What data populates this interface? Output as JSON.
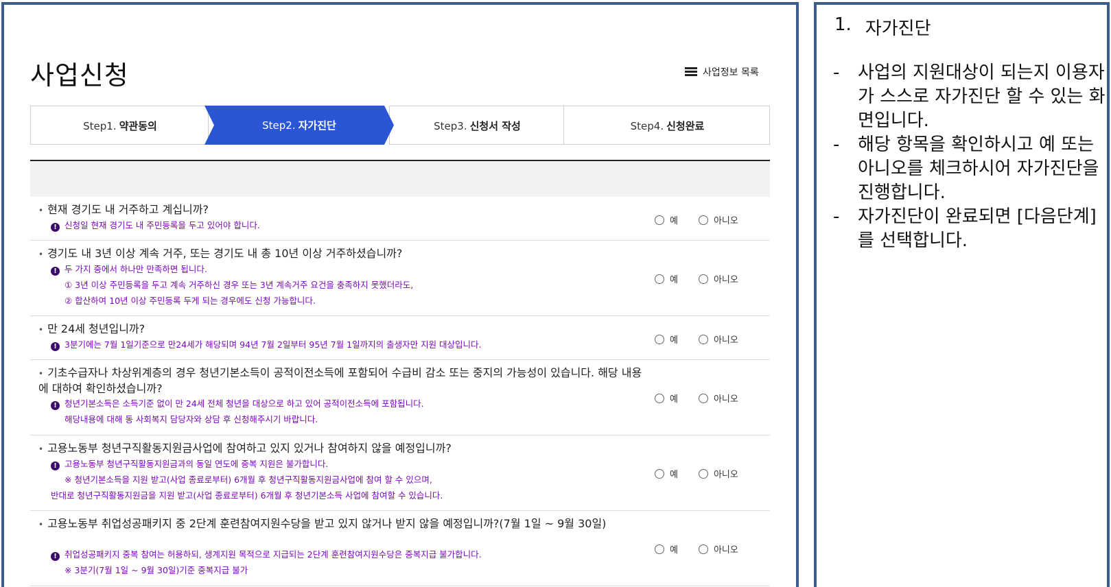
{
  "page": {
    "title": "사업신청",
    "list_link": "사업정보 목록"
  },
  "steps": [
    {
      "prefix": "Step1.",
      "label": "약관동의",
      "active": false
    },
    {
      "prefix": "Step2.",
      "label": "자가진단",
      "active": true
    },
    {
      "prefix": "Step3.",
      "label": "신청서 작성",
      "active": false
    },
    {
      "prefix": "Step4.",
      "label": "신청완료",
      "active": false
    }
  ],
  "colors": {
    "active_step": "#2a55d4",
    "note_text": "#7a0ab8",
    "panel_border": "#3b5c8e"
  },
  "radio_labels": {
    "yes": "예",
    "no": "아니오"
  },
  "questions": [
    {
      "title": "현재 경기도 내 거주하고 계십니까?",
      "note": "신청일 현재 경기도 내 주민등록을 두고 있어야 합니다.",
      "subs": []
    },
    {
      "title": "경기도 내 3년 이상 계속 거주, 또는 경기도 내 총 10년 이상 거주하셨습니까?",
      "note": "두 가지 중에서 하나만 만족하면 됩니다.",
      "subs": [
        "① 3년 이상 주민등록을 두고 계속 거주하신 경우 또는 3년 계속거주 요건을 충족하지 못했더라도,",
        "② 합산하여 10년 이상 주민등록 두게 되는 경우에도 신청 가능합니다."
      ]
    },
    {
      "title": "만 24세 청년입니까?",
      "note": "3분기에는 7월 1일기준으로 만24세가 해당되며 94년 7월 2일부터 95년 7월 1일까지의 출생자만 지원 대상입니다.",
      "subs": []
    },
    {
      "title": "기초수급자나 차상위계층의 경우 청년기본소득이 공적이전소득에 포함되어 수급비 감소 또는 중지의 가능성이 있습니다. 해당 내용에 대하여 확인하셨습니까?",
      "note": "청년기본소득은 소득기준 없이 만 24세 전체 청년을 대상으로 하고 있어 공적이전소득에 포함됩니다.",
      "subs": [
        "해당내용에 대해 동 사회복지 담당자와 상담 후 신청해주시기 바랍니다."
      ]
    },
    {
      "title": "고용노동부 청년구직활동지원금사업에 참여하고 있지 있거나 참여하지 않을 예정입니까?",
      "note": "고용노동부 청년구직활동지원금과의 동일 연도에 중복 지원은 불가합니다.",
      "subs": [
        "※ 청년기본소득을 지원 받고(사업 종료로부터) 6개월 후 청년구직활동지원금사업에 참여 할 수 있으며,",
        "반대로 청년구직활동지원금을 지원 받고(사업 종료로부터) 6개월 후 청년기본소득 사업에 참여할 수 있습니다."
      ]
    },
    {
      "title": "고용노동부 취업성공패키지 중 2단계 훈련참여지원수당을 받고 있지 않거나 받지 않을 예정입니까?(7월 1일 ~ 9월 30일)",
      "note": "취업성공패키지 중복 참여는 허용하되, 생계지원 목적으로 지급되는 2단계 훈련참여지원수당은 중복지급 불가합니다.",
      "subs": [
        "※ 3분기(7월 1일 ~ 9월 30일)기준 중복지급 불가"
      ]
    }
  ],
  "side": {
    "num": "1.",
    "heading": "자가진단",
    "items": [
      "사업의 지원대상이 되는지 이용자가 스스로 자가진단 할 수 있는 화면입니다.",
      "해당 항목을 확인하시고 예 또는 아니오를 체크하시어 자가진단을 진행합니다.",
      "자가진단이 완료되면 [다음단계]를 선택합니다."
    ]
  }
}
